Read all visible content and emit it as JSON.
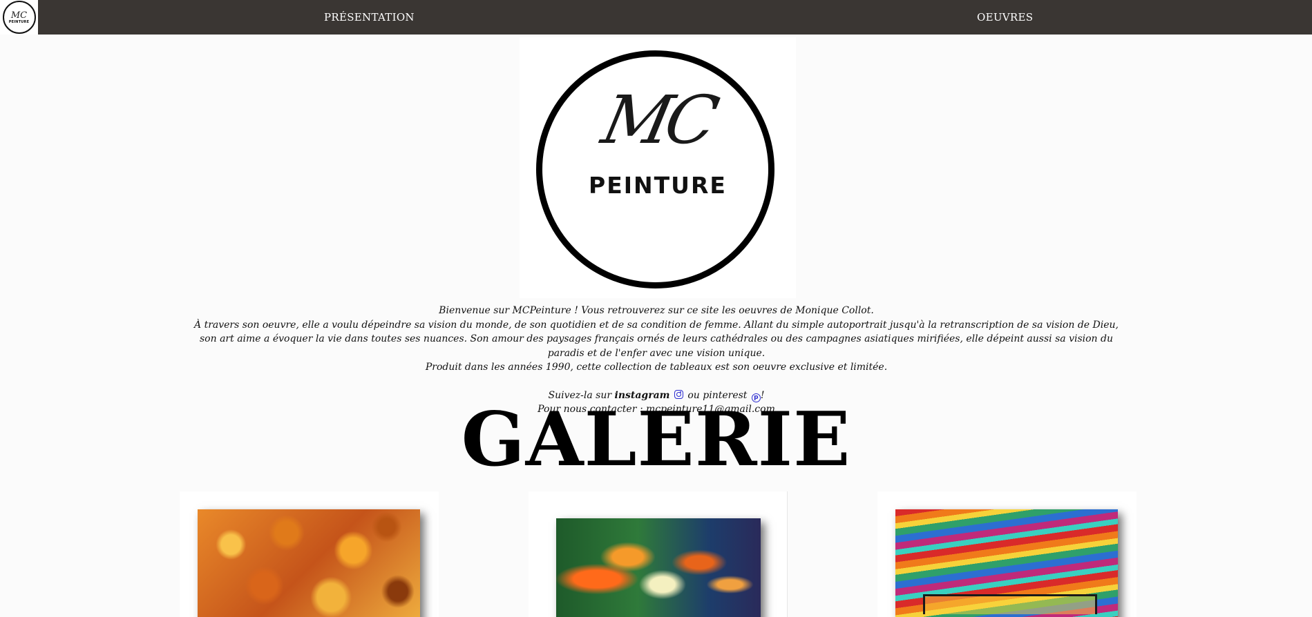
{
  "nav": {
    "logo_mc": "MC",
    "logo_peinture": "PEINTURE",
    "links": [
      {
        "label": "PRÉSENTATION"
      },
      {
        "label": "OEUVRES"
      }
    ]
  },
  "hero": {
    "logo_mc": "MC",
    "logo_peinture": "PEINTURE"
  },
  "intro": {
    "line1": "Bienvenue sur MCPeinture ! Vous retrouverez sur ce site les oeuvres de Monique Collot.",
    "line2": "À travers son oeuvre, elle a voulu dépeindre sa vision du monde, de son quotidien et de sa condition de femme. Allant du simple autoportrait jusqu'à la retranscription de sa vision de Dieu, son art aime a évoquer la vie dans toutes ses nuances. Son amour des paysages français ornés de leurs cathédrales ou des campagnes asiatiques mirifiées, elle dépeint aussi sa vision du paradis et de l'enfer avec une vision unique.",
    "line3": "Produit dans les années 1990, cette collection de tableaux est son oeuvre exclusive et limitée.",
    "follow_prefix": "Suivez-la sur ",
    "instagram_label": "instagram",
    "follow_middle": " ou pinterest ",
    "follow_suffix": "!",
    "contact": "Pour nous contacter : mcpeinture11@gmail.com"
  },
  "gallery": {
    "title": "GALERIE",
    "items": [
      {
        "icon": "painting-orange-flowers"
      },
      {
        "icon": "painting-flames-figure"
      },
      {
        "icon": "painting-colorful-stripes"
      }
    ]
  },
  "colors": {
    "nav_bg": "#3a3633",
    "page_bg": "#fbfbfb",
    "icon_link": "#2a2ad0"
  }
}
